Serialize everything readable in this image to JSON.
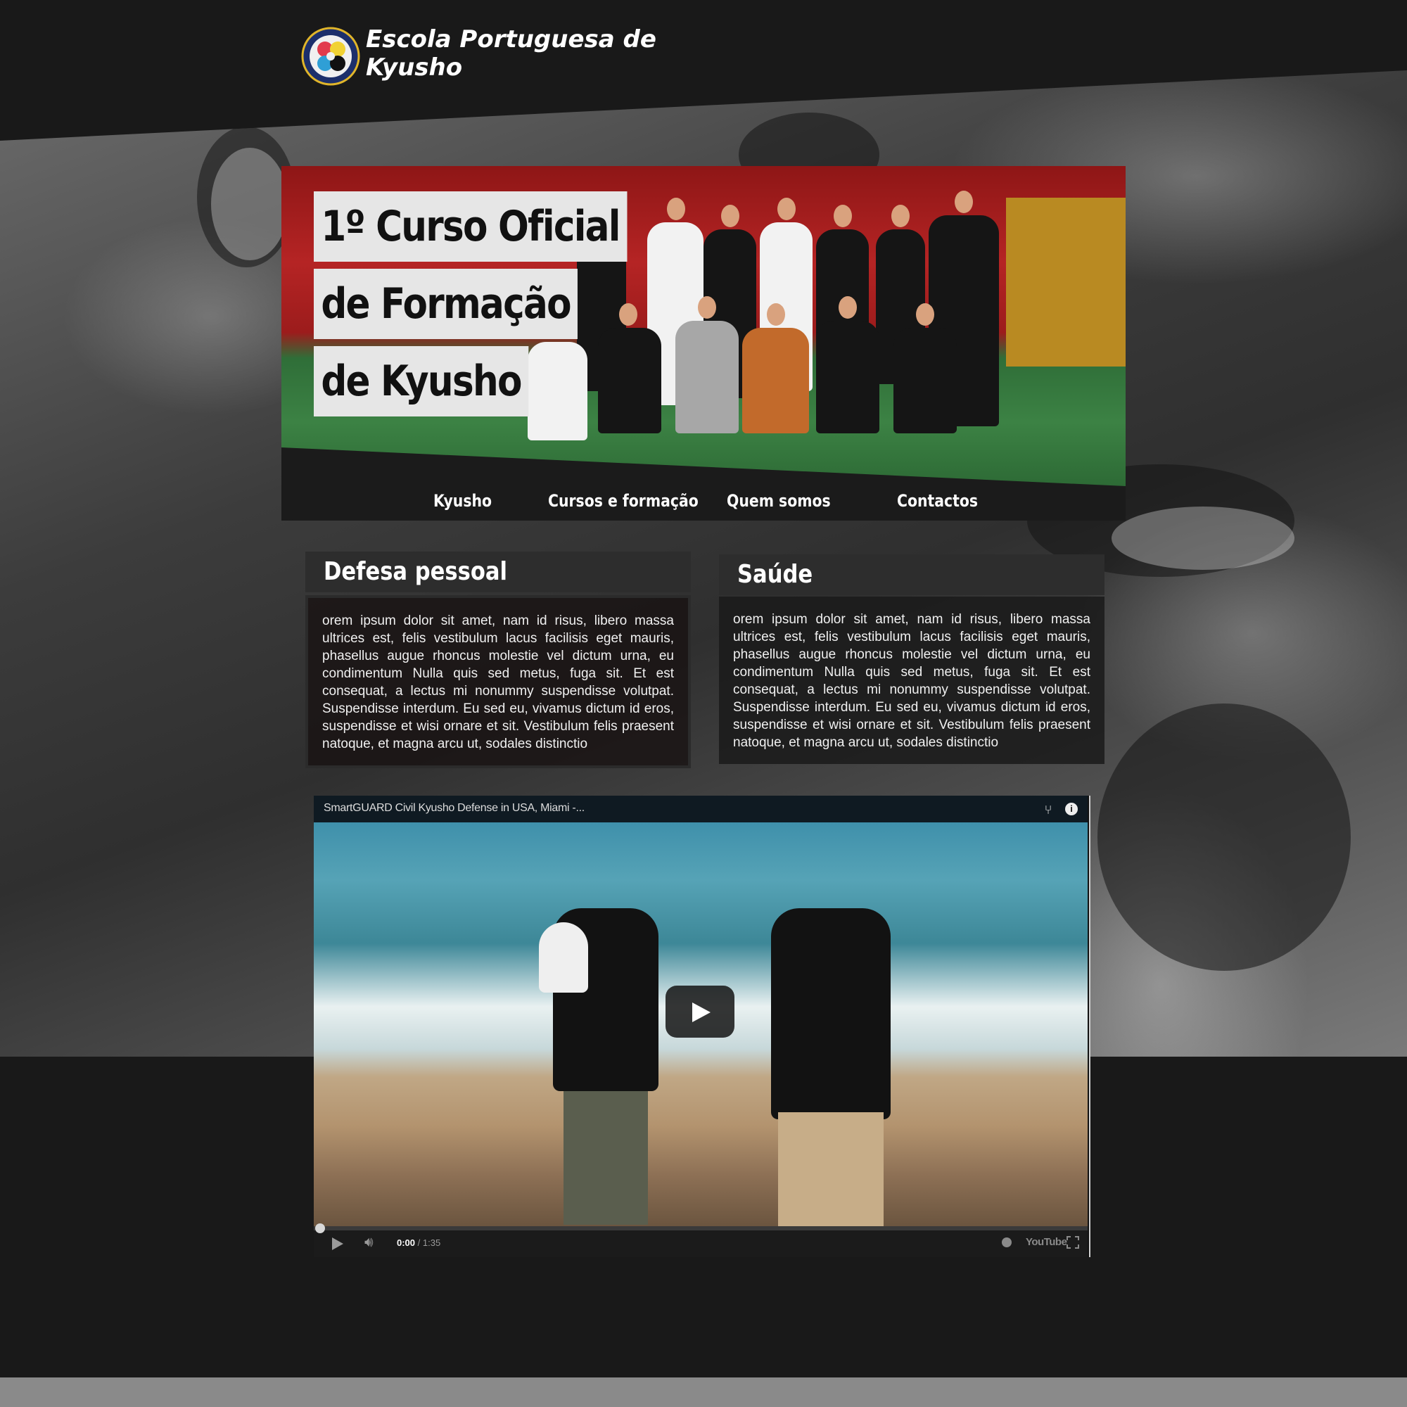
{
  "header": {
    "site_title": "Escola Portuguesa de Kyusho",
    "logo_icon": "kyusho-school-logo-icon"
  },
  "hero": {
    "title_lines": [
      "1º Curso Oficial",
      "de Formação",
      "de Kyusho"
    ]
  },
  "nav": {
    "items": [
      {
        "label": "Kyusho"
      },
      {
        "label": "Cursos e formação"
      },
      {
        "label": "Quem somos"
      },
      {
        "label": "Contactos"
      }
    ]
  },
  "panels": [
    {
      "title": "Defesa pessoal",
      "body": "orem ipsum dolor sit amet, nam id risus, libero massa ultrices est, felis vestibulum lacus facilisis eget mauris, phasellus augue rhoncus molestie vel dictum urna, eu condimentum Nulla quis sed metus, fuga sit. Et est consequat, a lectus mi nonummy suspendisse volutpat. Suspendisse interdum. Eu sed eu, vivamus dictum id eros, suspendisse et wisi ornare et sit. Vestibulum felis praesent natoque, et magna arcu ut, sodales distinctio"
    },
    {
      "title": "Saúde",
      "body": "orem ipsum dolor sit amet, nam id risus, libero massa ultrices est, felis vestibulum lacus facilisis eget mauris, phasellus augue rhoncus molestie vel dictum urna, eu condimentum Nulla quis sed metus, fuga sit. Et est consequat, a lectus mi nonummy suspendisse volutpat. Suspendisse interdum. Eu sed eu, vivamus dictum id eros, suspendisse et wisi ornare et sit. Vestibulum felis praesent natoque, et magna arcu ut, sodales distinctio"
    }
  ],
  "video": {
    "title": "SmartGUARD Civil Kyusho Defense in USA, Miami -...",
    "current_time": "0:00",
    "duration": "1:35",
    "time_separator": " / ",
    "progress": 0,
    "icons": {
      "share": "share-icon",
      "info": "info-icon",
      "play": "play-icon",
      "volume": "volume-icon",
      "watch_later": "clock-icon",
      "fullscreen": "fullscreen-icon"
    },
    "brand": "YouTube"
  },
  "colors": {
    "page_background": "#191919",
    "panel_header": "#2d2d2d",
    "hero_label_background": "#e6e6e6",
    "footer_strip": "#8a8a8a"
  }
}
